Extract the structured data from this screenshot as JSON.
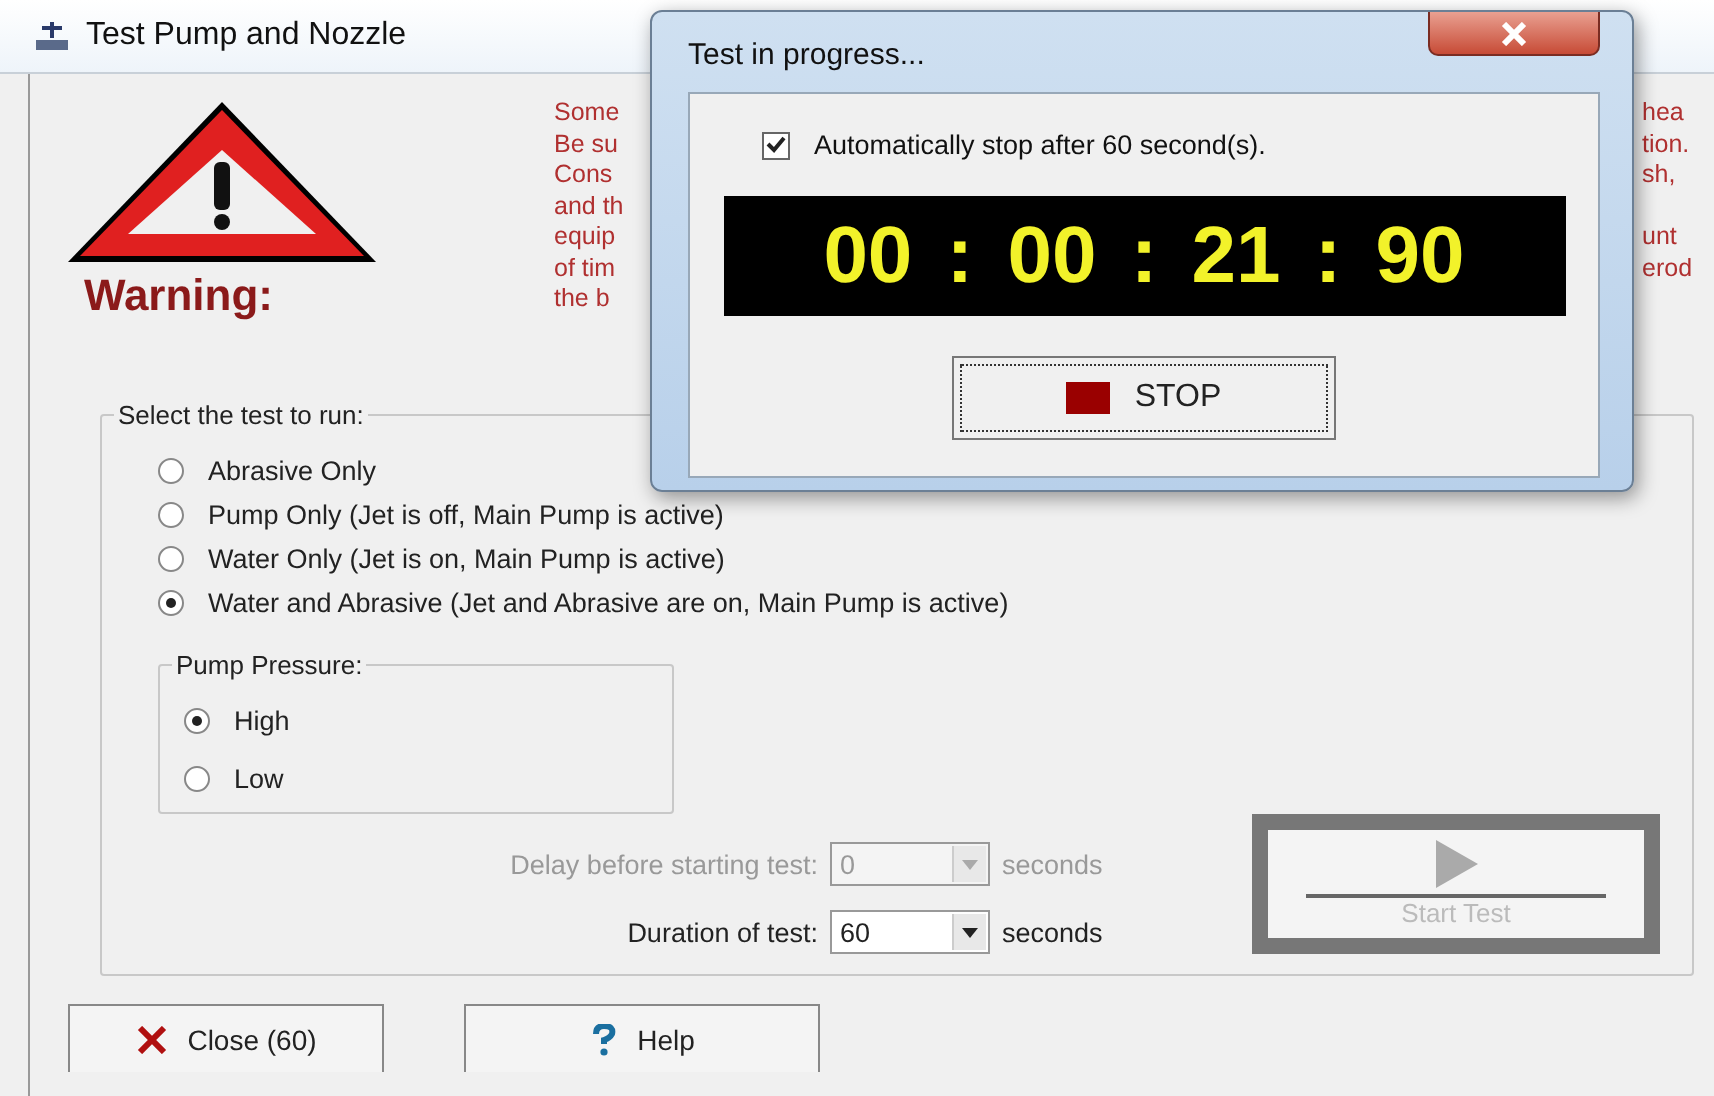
{
  "main_window": {
    "title": "Test Pump and Nozzle",
    "warning": {
      "label": "Warning:",
      "lines": [
        {
          "left": "Some",
          "right": "hea"
        },
        {
          "left": "Be su",
          "right": "tion."
        },
        {
          "left": "Cons",
          "right": "sh,"
        },
        {
          "left": "and th"
        },
        {
          "left": "equip",
          "right": "unt"
        },
        {
          "left": "of tim",
          "right": "erod"
        },
        {
          "left": "the b"
        }
      ]
    },
    "test_group": {
      "label": "Select the test to run:",
      "options": [
        {
          "label": "Abrasive Only",
          "selected": false
        },
        {
          "label": "Pump Only (Jet is off, Main Pump is active)",
          "selected": false
        },
        {
          "label": "Water Only (Jet is on, Main Pump is active)",
          "selected": false
        },
        {
          "label": "Water and Abrasive (Jet and Abrasive are on, Main Pump is active)",
          "selected": true
        }
      ],
      "pressure_group": {
        "label": "Pump Pressure:",
        "options": [
          {
            "label": "High",
            "selected": true
          },
          {
            "label": "Low",
            "selected": false
          }
        ]
      },
      "fields": [
        {
          "label": "Delay before starting test:",
          "value": "0",
          "unit": "seconds",
          "disabled": true
        },
        {
          "label": "Duration of test:",
          "value": "60",
          "unit": "seconds",
          "disabled": false
        }
      ],
      "start_button": {
        "label": "Start Test",
        "disabled": true
      }
    },
    "buttons": [
      {
        "kind": "close",
        "label": "Close (60)"
      },
      {
        "kind": "help",
        "label": "Help"
      }
    ]
  },
  "dialog": {
    "title": "Test in progress...",
    "auto_stop": {
      "label": "Automatically stop after 60 second(s).",
      "checked": true
    },
    "timer": "00 : 00 : 21 : 90",
    "stop_button": "STOP"
  }
}
